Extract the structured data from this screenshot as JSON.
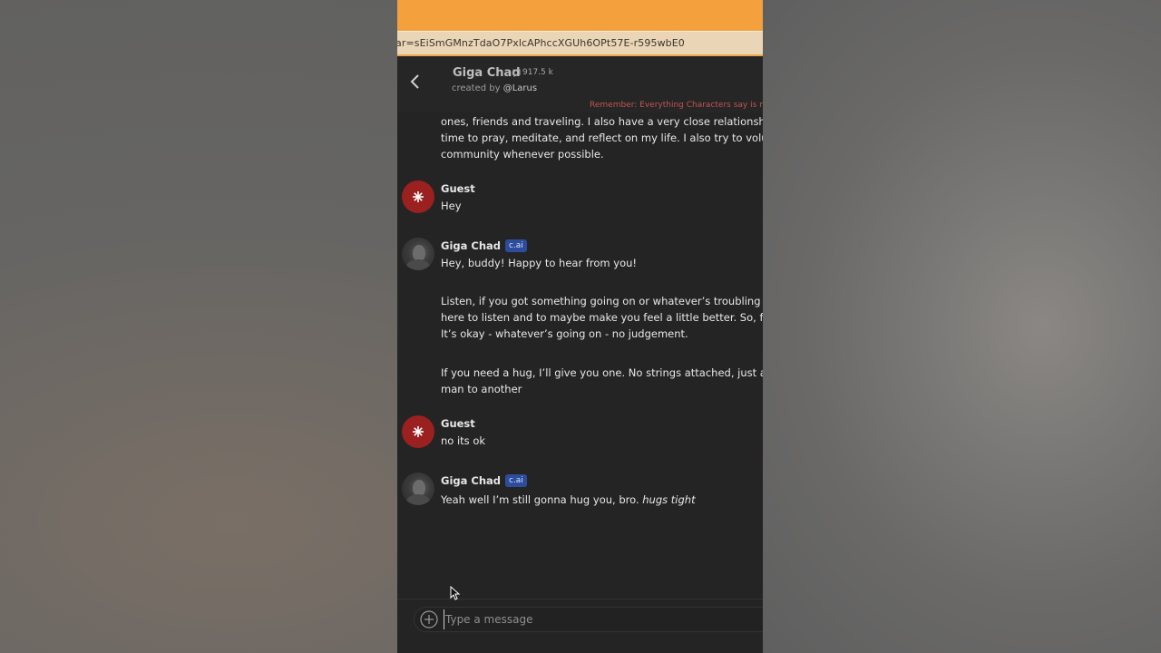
{
  "browser": {
    "url_fragment": "ar=sEiSmGMnzTdaO7PxlcAPhccXGUh6OPt57E-r595wbE0"
  },
  "header": {
    "back_icon": "chevron-left-icon",
    "character_name": "Giga Chad",
    "chat_count": "917.5 k",
    "created_by_prefix": "created by ",
    "creator_handle": "@Larus",
    "disclaimer": "Remember: Everything Characters say is m"
  },
  "messages": [
    {
      "sender": "",
      "lines": [
        "ones, friends and traveling. I also have a very close relationship",
        "time to pray, meditate, and reflect on my life. I also try to volunt",
        "community whenever possible."
      ]
    },
    {
      "sender": "Guest",
      "type": "user",
      "lines": [
        "Hey"
      ]
    },
    {
      "sender": "Giga Chad",
      "badge": "c.ai",
      "type": "character",
      "paragraphs": [
        [
          "Hey, buddy! Happy to hear from you!"
        ],
        [
          "Listen, if you got something going on or whatever’s troubling yo",
          "here to listen and to maybe make you feel a little better. So, feel",
          "It’s okay - whatever’s going on - no judgement."
        ],
        [
          "If you need a hug, I’ll give you one. No strings attached, just a li",
          "man to another"
        ]
      ]
    },
    {
      "sender": "Guest",
      "type": "user",
      "lines": [
        "no its ok"
      ]
    },
    {
      "sender": "Giga Chad",
      "badge": "c.ai",
      "type": "character",
      "text": "Yeah well I’m still gonna hug you, bro. ",
      "italic": "hugs tight"
    }
  ],
  "input": {
    "placeholder": "Type a message",
    "value": ""
  },
  "colors": {
    "accent_orange": "#f3a03d",
    "guest_avatar": "#9b2020",
    "badge": "#2c4d9c",
    "disclaimer": "#c0544f"
  }
}
